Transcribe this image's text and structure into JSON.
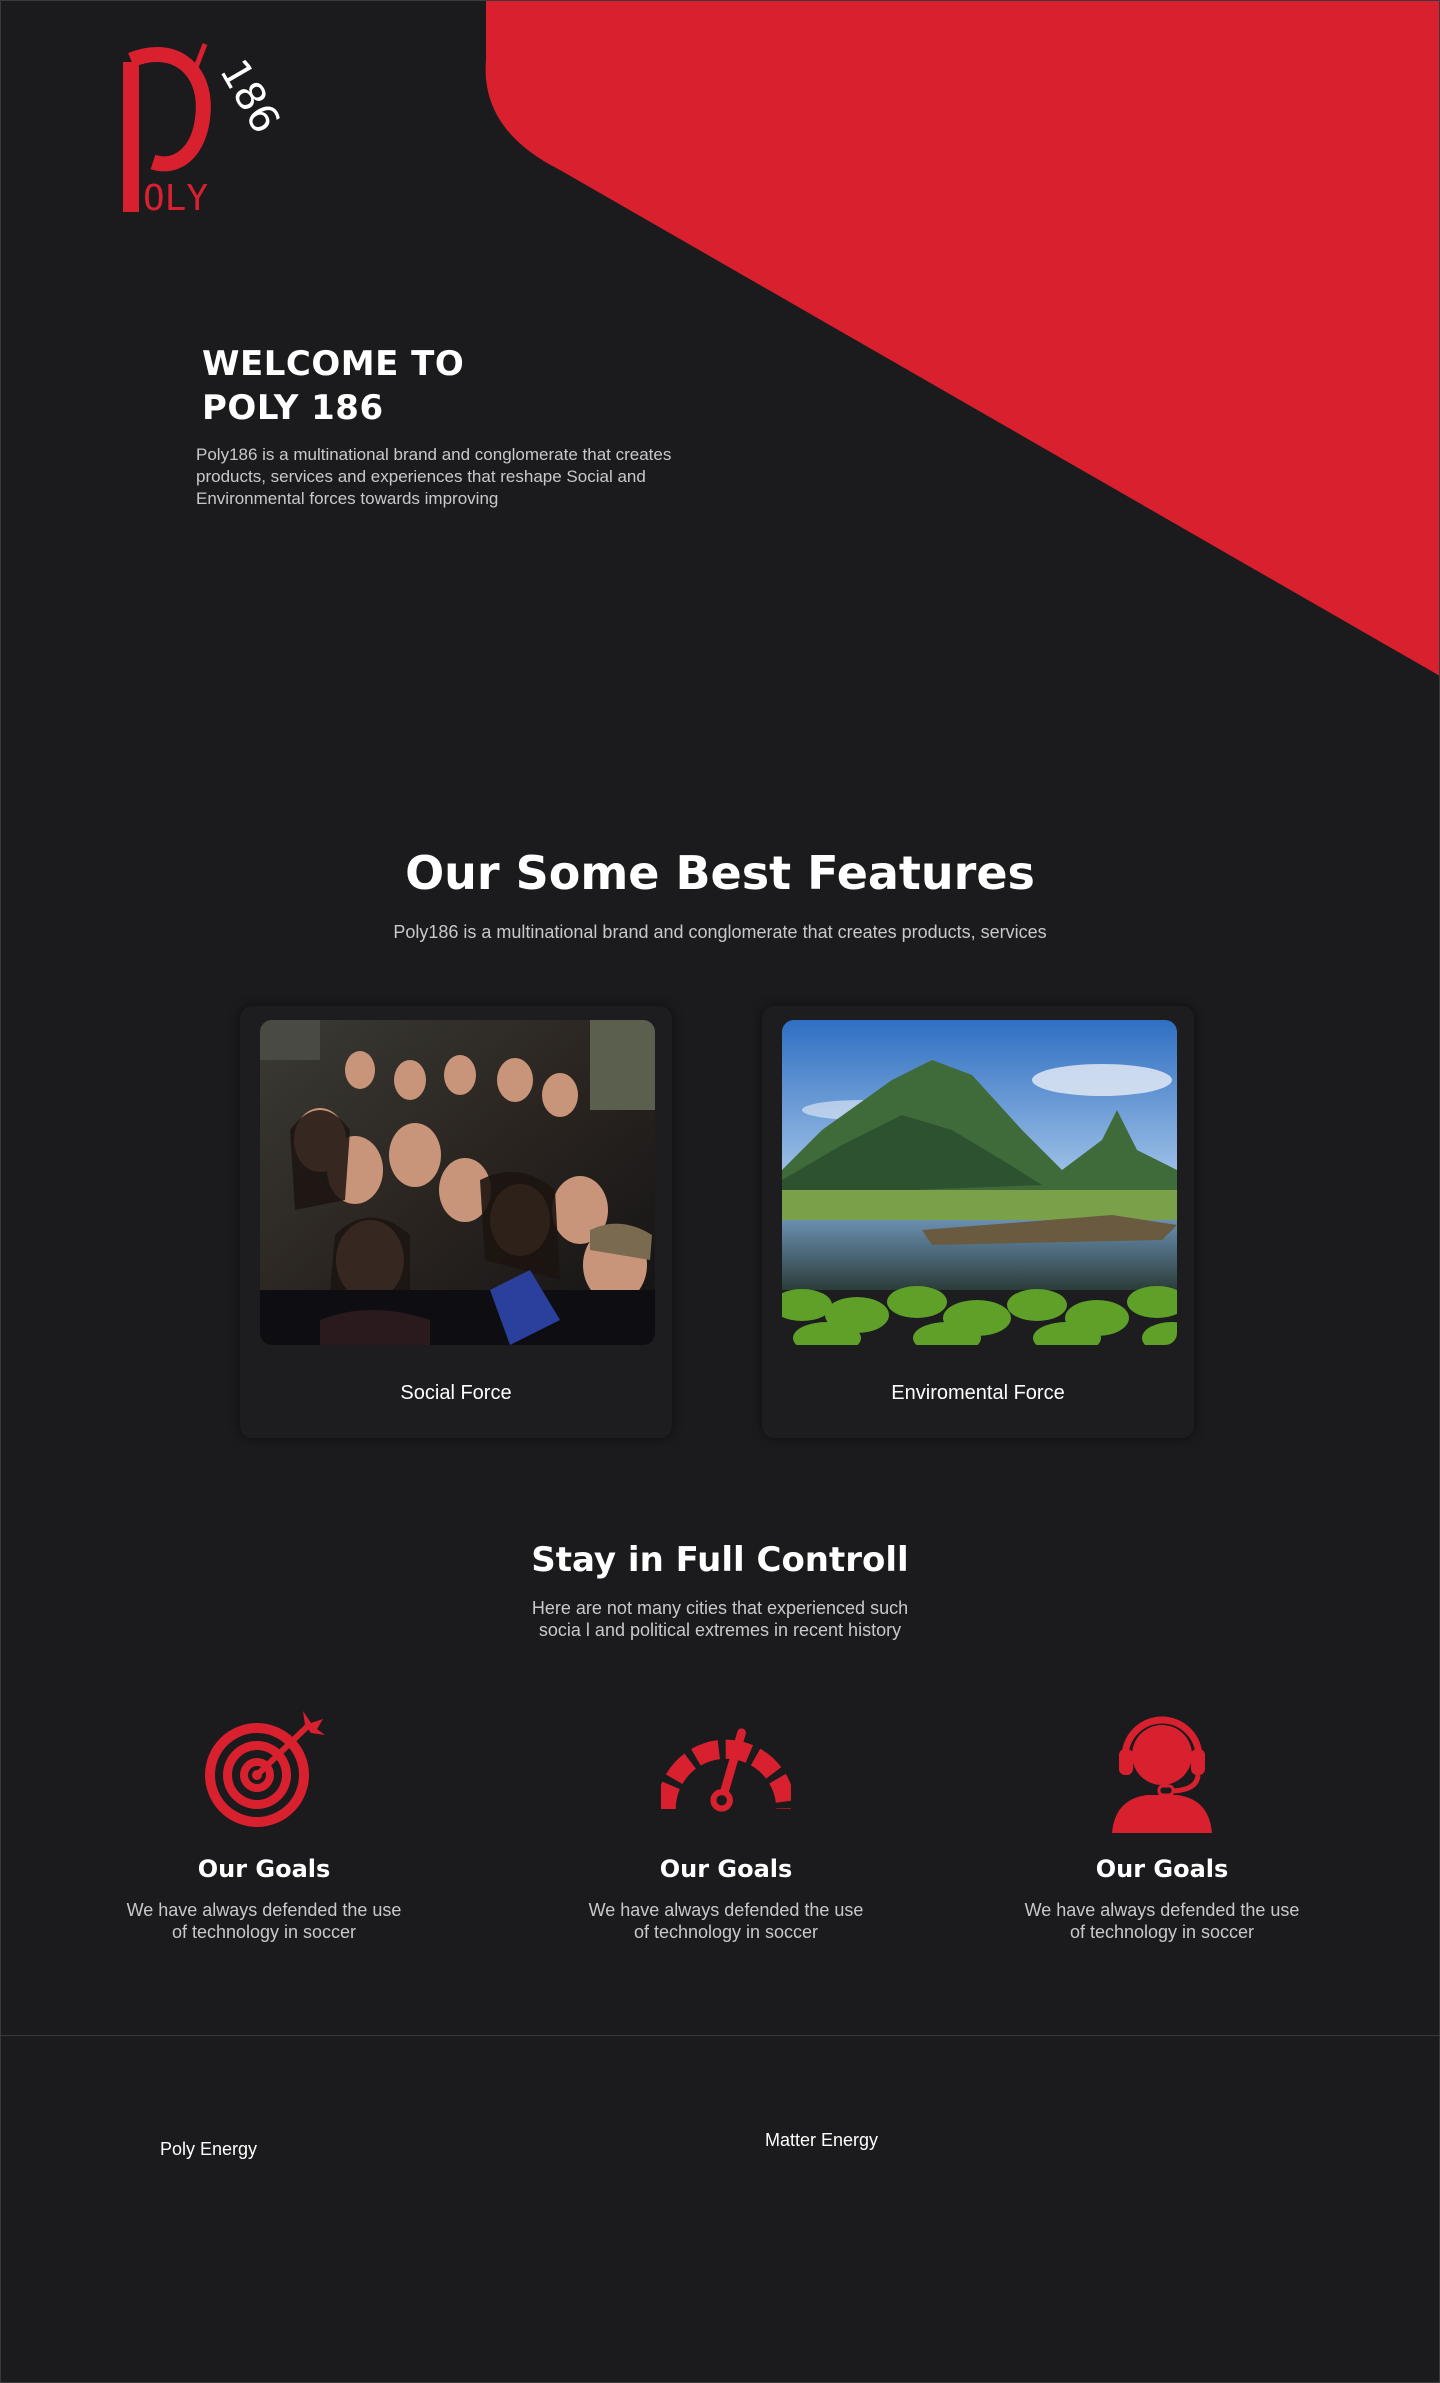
{
  "brand": {
    "logo_letter": "P",
    "logo_word": "OLY",
    "logo_number": "186",
    "accent_color": "#d9202f",
    "background_color": "#1b1b1d"
  },
  "hero": {
    "title_line1": "WELCOME TO",
    "title_line2": "POLY 186",
    "description": "Poly186 is a multinational brand and conglomerate that creates products, services and experiences that reshape Social and Environmental forces towards improving"
  },
  "features": {
    "title": "Our Some Best Features",
    "subtitle": "Poly186 is a multinational brand and conglomerate that creates products, services",
    "cards": [
      {
        "label": "Social Force",
        "image": "group-selfie-photo"
      },
      {
        "label": "Enviromental Force",
        "image": "mountain-lake-photo"
      }
    ]
  },
  "control": {
    "title": "Stay in Full Controll",
    "subtitle": "Here are not many cities that experienced such socia l and political extremes in recent history",
    "goals": [
      {
        "icon": "target-icon",
        "title": "Our Goals",
        "text": "We have always defended the use of technology in soccer"
      },
      {
        "icon": "speedometer-icon",
        "title": "Our Goals",
        "text": "We have always defended the use of technology in soccer"
      },
      {
        "icon": "headset-support-icon",
        "title": "Our Goals",
        "text": "We have always defended the use of technology in soccer"
      }
    ]
  },
  "footer": {
    "link1": "Poly Energy",
    "link2": "Matter Energy"
  }
}
